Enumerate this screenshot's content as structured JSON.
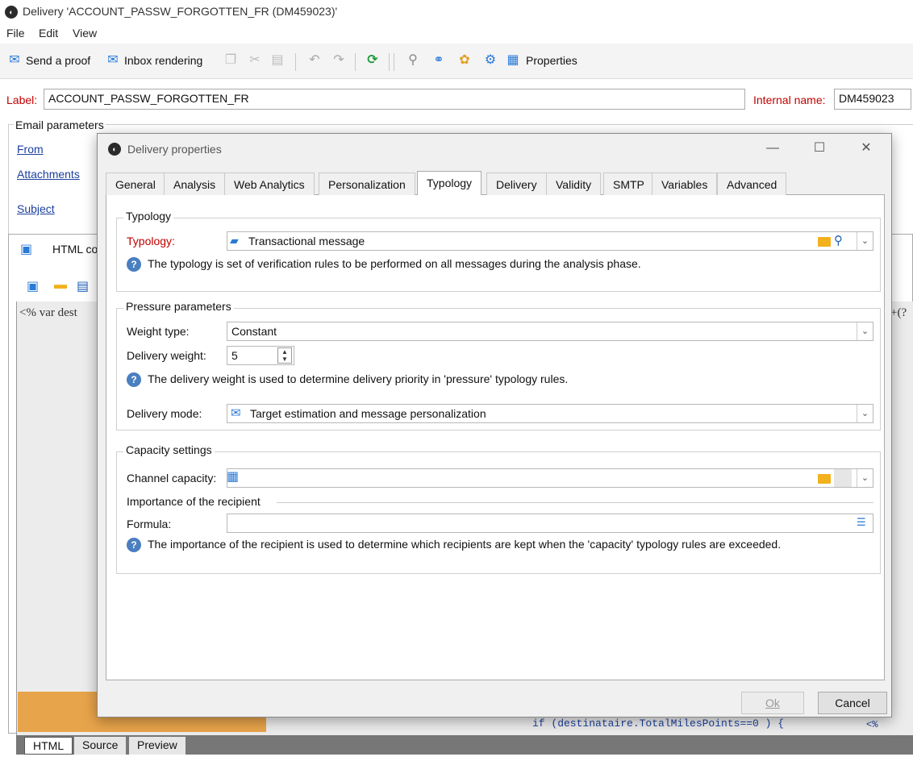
{
  "window": {
    "title": "Delivery 'ACCOUNT_PASSW_FORGOTTEN_FR (DM459023)'"
  },
  "menu": {
    "file": "File",
    "edit": "Edit",
    "view": "View"
  },
  "toolbar": {
    "send_proof": "Send a proof",
    "inbox_rendering": "Inbox rendering",
    "properties": "Properties"
  },
  "label_row": {
    "label_caption": "Label:",
    "label_value": "ACCOUNT_PASSW_FORGOTTEN_FR",
    "internal_caption": "Internal name:",
    "internal_value": "DM459023"
  },
  "email_params": {
    "legend": "Email parameters",
    "from": "From",
    "attachments": "Attachments",
    "subject": "Subject"
  },
  "html_area": {
    "title": "HTML co",
    "code": "<% var dest",
    "code_right": "+(?",
    "code_line": "if (destinataire.TotalMilesPoints==0 ) {",
    "code_line_right": "<%"
  },
  "bottom_tabs": [
    "HTML",
    "Source",
    "Preview"
  ],
  "dialog": {
    "title": "Delivery properties",
    "tabs": [
      "General",
      "Analysis",
      "Web Analytics",
      "Personalization",
      "Typology",
      "Delivery",
      "Validity",
      "SMTP",
      "Variables",
      "Advanced"
    ],
    "active_tab": "Typology",
    "typology": {
      "legend": "Typology",
      "label": "Typology:",
      "value": "Transactional message",
      "help": "The typology is set of verification rules to be performed on all messages during the analysis phase."
    },
    "pressure": {
      "legend": "Pressure parameters",
      "weight_type_label": "Weight type:",
      "weight_type_value": "Constant",
      "delivery_weight_label": "Delivery weight:",
      "delivery_weight_value": "5",
      "help": "The delivery weight is used to determine delivery priority in 'pressure' typology rules.",
      "delivery_mode_label": "Delivery mode:",
      "delivery_mode_value": "Target estimation and message personalization"
    },
    "capacity": {
      "legend": "Capacity settings",
      "channel_capacity_label": "Channel capacity:",
      "importance_legend": "Importance of the recipient",
      "formula_label": "Formula:",
      "help": "The importance of the recipient is used to determine which recipients are kept when the 'capacity' typology rules are exceeded."
    },
    "ok": "Ok",
    "cancel": "Cancel"
  },
  "colors": {
    "required_label": "#c00000",
    "link": "#1b3f9c",
    "help_icon": "#4a7fc0",
    "folder_icon": "#f2b11d",
    "editor_orange": "#e8a44a"
  }
}
